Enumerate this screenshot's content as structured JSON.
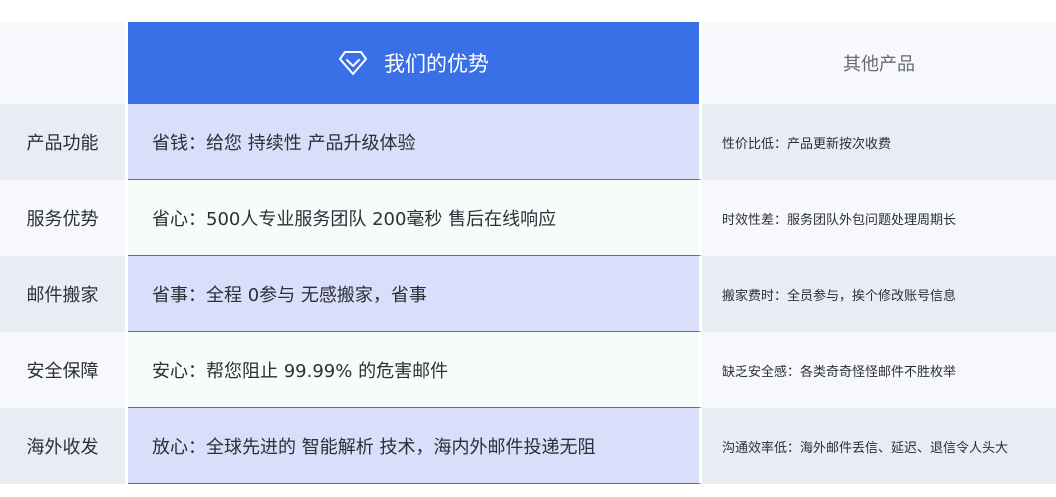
{
  "header": {
    "ours_title": "我们的优势",
    "other_title": "其他产品",
    "ours_icon": "diamond-icon"
  },
  "rows": [
    {
      "label": "产品功能",
      "ours": "省钱：给您 持续性 产品升级体验",
      "other": "性价比低：产品更新按次收费"
    },
    {
      "label": "服务优势",
      "ours": "省心：500人专业服务团队 200毫秒 售后在线响应",
      "other": "时效性差：服务团队外包问题处理周期长"
    },
    {
      "label": "邮件搬家",
      "ours": "省事：全程 0参与 无感搬家，省事",
      "other": "搬家费时：全员参与，挨个修改账号信息"
    },
    {
      "label": "安全保障",
      "ours": "安心：帮您阻止 99.99% 的危害邮件",
      "other": "缺乏安全感：各类奇奇怪怪邮件不胜枚举"
    },
    {
      "label": "海外收发",
      "ours": "放心：全球先进的 智能解析 技术，海内外邮件投递无阻",
      "other": "沟通效率低：海外邮件丢信、延迟、退信令人头大"
    }
  ],
  "colors": {
    "accent": "#3970e8",
    "highlight_row": "#d9defa",
    "plain_row": "#f7fcfb",
    "label_bg_dark": "#e9edf3",
    "label_bg_light": "#f6f8fb"
  }
}
